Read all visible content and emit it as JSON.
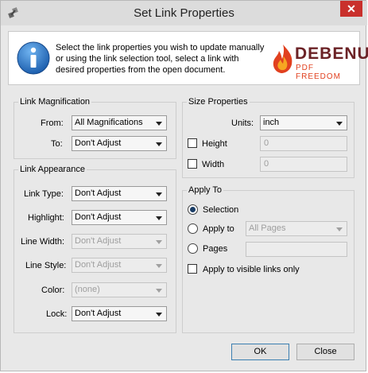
{
  "window": {
    "title": "Set Link Properties",
    "close_glyph": "✕"
  },
  "banner": {
    "text": "Select the link properties you wish to update manually or using the link selection tool, select a link with desired properties from the open document.",
    "logo_name": "DEBENU",
    "logo_tagline": "PDF FREEDOM",
    "logo_colors": {
      "name": "#6b2226",
      "accent": "#e1401f"
    }
  },
  "magnification": {
    "title": "Link Magnification",
    "from_label": "From:",
    "from_value": "All Magnifications",
    "to_label": "To:",
    "to_value": "Don't Adjust"
  },
  "appearance": {
    "title": "Link Appearance",
    "link_type_label": "Link Type:",
    "link_type_value": "Don't Adjust",
    "highlight_label": "Highlight:",
    "highlight_value": "Don't Adjust",
    "line_width_label": "Line Width:",
    "line_width_value": "Don't Adjust",
    "line_style_label": "Line Style:",
    "line_style_value": "Don't Adjust",
    "color_label": "Color:",
    "color_value": "(none)",
    "lock_label": "Lock:",
    "lock_value": "Don't Adjust"
  },
  "size": {
    "title": "Size Properties",
    "units_label": "Units:",
    "units_value": "inch",
    "height_label": "Height",
    "height_value": "0",
    "width_label": "Width",
    "width_value": "0"
  },
  "apply_to": {
    "title": "Apply To",
    "selection_label": "Selection",
    "apply_to_label": "Apply to",
    "pages_dropdown_value": "All Pages",
    "pages_label": "Pages",
    "pages_value": "",
    "visible_only_label": "Apply to visible links only"
  },
  "buttons": {
    "ok": "OK",
    "close": "Close"
  },
  "icons": {
    "app": "link-tool-icon",
    "info": "info-icon",
    "logo_mark": "flame-logo-icon"
  }
}
